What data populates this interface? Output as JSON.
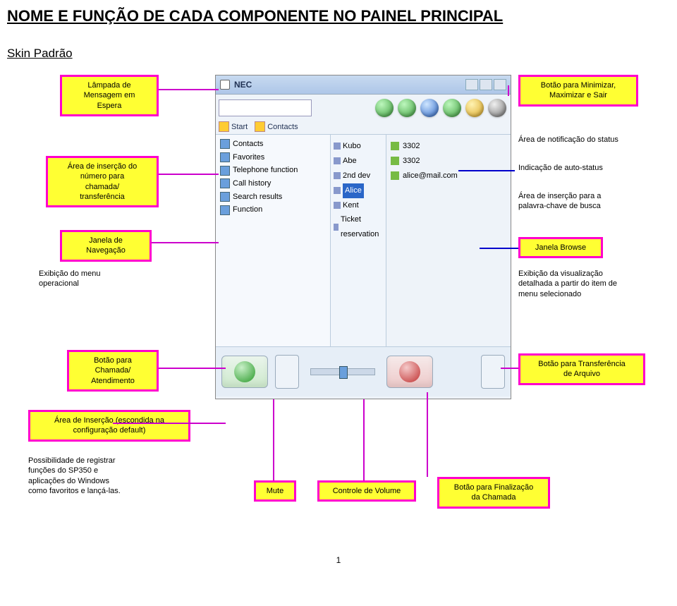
{
  "title": "NOME E FUNÇÃO DE CADA COMPONENTE NO PAINEL PRINCIPAL",
  "subtitle": "Skin Padrão",
  "callouts": {
    "lamp": "Lâmpada de\nMensagem em\nEspera",
    "minmax": "Botão para Minimizar,\nMaximizar e Sair",
    "status_area": "Área de notificação do status",
    "transfer_input": "Área de inserção do\nnúmero para\nchamada/\ntransferência",
    "auto_status": "Indicação de auto-status",
    "kw_area": "Área de inserção para a\npalavra-chave de busca",
    "nav_window": "Janela de\nNavegação",
    "browse_window": "Janela Browse",
    "op_menu": "Exibição do menu\noperacional",
    "detail_view": "Exibição da visualização\ndetalhada a partir do item de\nmenu selecionado",
    "call_btn": "Botão para\nChamada/\nAtendimento",
    "file_btn": "Botão para Transferência\nde Arquivo",
    "hidden_input": "Área de Inserção (escondida na\nconfiguração default)",
    "favorites": "Possibilidade de registrar\nfunções do SP350 e\naplicações do Windows\ncomo favoritos e lançá-las.",
    "mute": "Mute",
    "vol": "Controle de Volume",
    "end_call": "Botão para Finalização\nda Chamada"
  },
  "mock": {
    "brand": "NEC",
    "tabs": {
      "start": "Start",
      "contacts": "Contacts"
    },
    "nav_items": [
      "Contacts",
      "Favorites",
      "Telephone function",
      "Call history",
      "Search results",
      "Function"
    ],
    "mid_items": [
      "Kubo",
      "Abe",
      "2nd dev",
      "Alice",
      "Kent",
      "Ticket reservation"
    ],
    "details": [
      "3302",
      "3302",
      "alice@mail.com"
    ]
  },
  "page_number": "1"
}
